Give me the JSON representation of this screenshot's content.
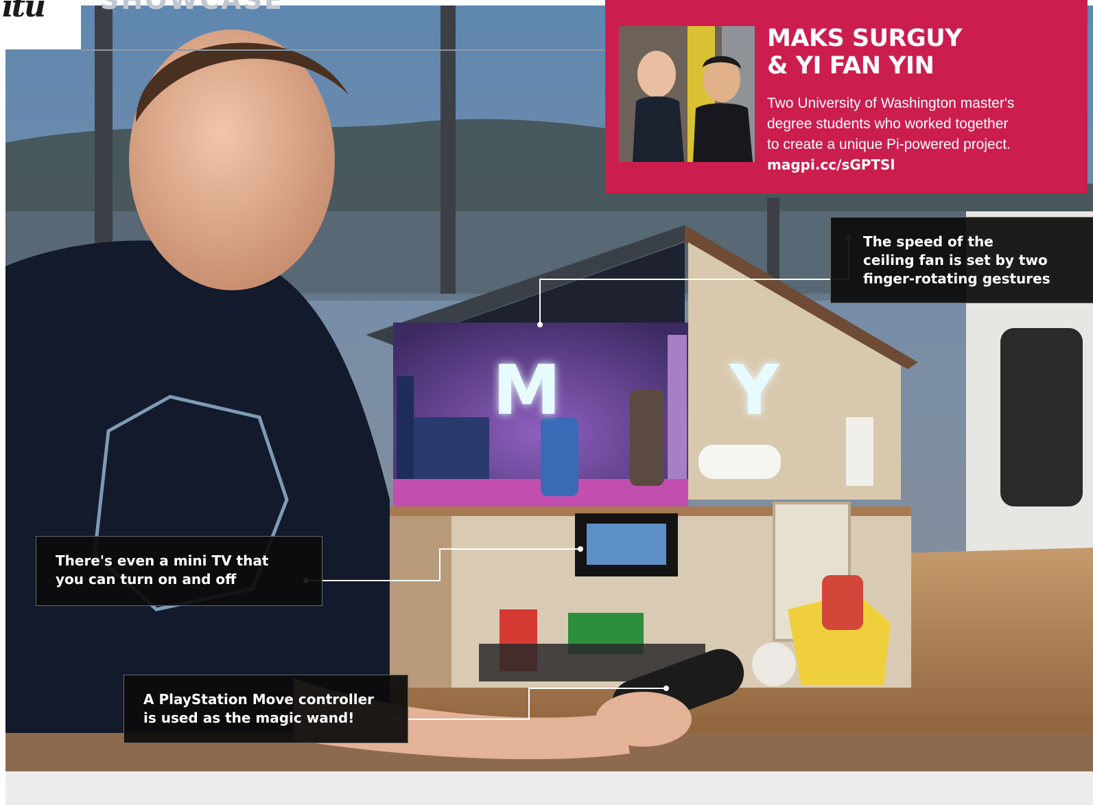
{
  "header": {
    "logo_text": "ıtu",
    "section_label": "SHOWCASE"
  },
  "profile": {
    "name_line1": "MAKS SURGUY",
    "name_line2": "& YI FAN YIN",
    "description_lines": [
      "Two University of Washington master's",
      "degree students who worked together",
      "to create a unique Pi-powered project."
    ],
    "link": "magpi.cc/sGPTSl"
  },
  "photo": {
    "letters": [
      "M",
      "Y"
    ]
  },
  "callouts": {
    "fan": [
      "The speed of the",
      "ceiling fan is set by two",
      "finger-rotating gestures"
    ],
    "tv": [
      "There's even a mini TV that",
      "you can turn on and off"
    ],
    "wand": [
      "A PlayStation Move controller",
      "is used as the magic wand!"
    ]
  },
  "colors": {
    "accent": "#cb1e4e",
    "callout_bg": "#0c0c0c",
    "letter_glow": "#e7fbff"
  }
}
